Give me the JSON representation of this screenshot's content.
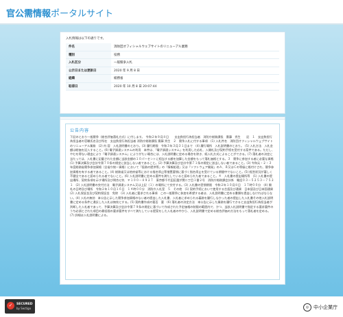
{
  "header": {
    "brand_main": "官公需情報",
    "brand_sub": "ポータルサイト"
  },
  "info": {
    "intro": "入札情報は以下の通りです。",
    "rows": [
      {
        "label": "件名",
        "value": "消防団オフィシャルウェブサイトのリニューアル業務"
      },
      {
        "label": "種別",
        "value": "役務"
      },
      {
        "label": "入札区分",
        "value": "一般競争入札"
      },
      {
        "label": "公示日または更新日",
        "value": "2020 年 9 月 8 日"
      },
      {
        "label": "組織",
        "value": "総務省"
      },
      {
        "label": "取得日",
        "value": "2020 年 10 月 8 日 20:07:44"
      }
    ]
  },
  "notice": {
    "title": "公告内容",
    "body": "下記のとおり一般競争（総合評価落札方式）に付します。　令和２年９月８日　　支出負担行為担当者　消防庁総務課長　齋藤　秀生　　記　１　支出負担行為担当者の官職氏名及び所在　支出負担行為担当者 消防庁総務課長 齋藤 秀生　２　競争入札に付する事項　(1) 入札件名　消防団オフィシャルウェブサイトのリニューアル業務　(2) 内 容　入札説明書のとおり。(3) 履行期限　令和３年３月３１日まで　(4) 履行場所　入札説明書のとおり。　(5) 入札方法　入札金額は総価を記入すること。(6) 電子調達システムの利用　本件は、「電子調達システム」を利用した応札、入開札及び契約手続を受付する案件である。ただし、やむを得ない理由により「電子調達システム」によりがたい場合には、入札説明書に定める場合を除き、紙入札方式によることができる。(7) 落札者の決定に当たっては、入札書に記載された金額に当該金額の１０パーセントに相当する額を加算した金額をもって落札価格とする。３　競争に参加する者に必要な資格　(1) 予算決算及び会計令第７０条の規定に該当しない者であること。(2) 予算決算及び会計令第７１条の規定に該当しない者であること。(3) 令和元・２・３年度総務省競争参加資格（全省庁統一資格）において「役務の提供等」の「情報処理」又は「ソフトウェア開発」のＡ、Ｂ又はＣの等級に格付けされ、競争参加資格を有する者であること。(4) 総務省又は他府省等における指名停止等措置要領に基づく指名停止を受けている期間中でないこと。(5) 経営状況が著しく不健全であると認められる者でないこと。(6) 入札説明書に定める要件を満たしていると認められた者であること。４　入札書の提出場所等　(1) 入札書の提出場所、契約条項を示す場所及び問合せ先　〒１００－８９２７　東京都千代田区霞が関二丁目１番２号　消防庁総務課会計係　電話０３－５２５３－７５２１　(2) 入札説明書の交付方法　電子調達システム又は上記（１）の場所にて交付する。(3) 入札書の受領期限　令和２年１０月８日　１７時００分　(4) 開札の日時及び場所　令和２年１０月１６日　１４時００分　消防庁入札室　５　その他　(1) 契約手続において使用する言語及び通貨　日本語及び日本国通貨　(2) 入札保証金及び契約保証金　免除　(3) 入札者に要求される事項　この一般競争に参加を希望する者は、入札説明書に定める書類を提出しなければならない。(4) 入札の無効　本公告に示した競争参加資格のない者の提出した入札書、入札者に求められる義務を履行しなかった者の提出した入札書その他入札説明書に定める条件に違反した入札は無効とする。(5) 契約書作成の要否　要　(6) 落札者の決定方法　本公告に示した業務を履行できると支出負担行為担当者が判断した入札者であって、予算決算及び会計令第７９条の規定に基づいて作成された予定価格の制限の範囲内で、かつ、当該入札説明書で指定する要求要件のうち必須とされた項目の最低限の要求要件をすべて満たしている提案をした入札者の中から、入札説明書で定める総合評価の方法をもって落札者を定める。(7) 詳細は入札説明書による。"
  },
  "footer": {
    "secured_line1": "SECURED",
    "secured_line2": "by Sectigo",
    "agency": "中小企業庁"
  },
  "colors": {
    "accent": "#2a8fd0",
    "stage_top": "#bfe3f2",
    "stage_bottom": "#6ec1e6"
  }
}
